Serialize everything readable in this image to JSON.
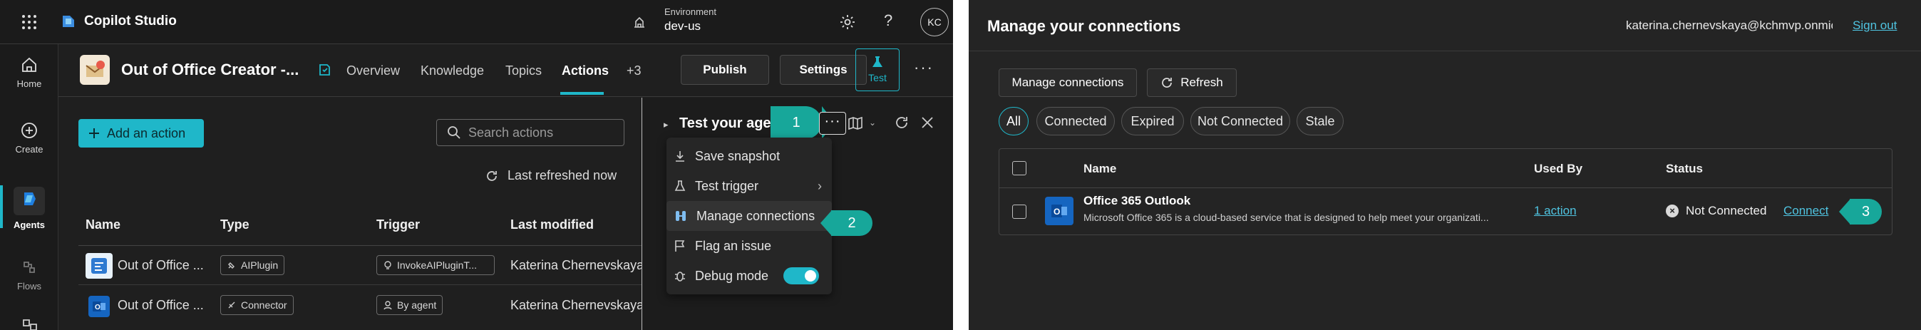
{
  "left": {
    "app_title": "Copilot Studio",
    "environment_label": "Environment",
    "environment_value": "dev-us",
    "avatar_initials": "KC",
    "rail": [
      "Home",
      "Create",
      "Agents",
      "Flows"
    ],
    "agent_name": "Out of Office Creator -...",
    "tabs": [
      "Overview",
      "Knowledge",
      "Topics",
      "Actions",
      "+3"
    ],
    "active_tab": "Actions",
    "publish_label": "Publish",
    "settings_label": "Settings",
    "test_label": "Test",
    "add_action_label": "Add an action",
    "search_placeholder": "Search actions",
    "refreshed_text": "Last refreshed now",
    "table_headers": [
      "Name",
      "Type",
      "Trigger",
      "Last modified"
    ],
    "rows": [
      {
        "name": "Out of Office ...",
        "type": "AIPlugin",
        "trigger": "InvokeAIPluginT...",
        "modified": "Katerina Chernevskaya..."
      },
      {
        "name": "Out of Office ...",
        "type": "Connector",
        "trigger": "By agent",
        "modified": "Katerina Chernevskaya..."
      }
    ],
    "test_panel_title": "Test your agent",
    "menu": [
      "Save snapshot",
      "Test trigger",
      "Manage connections",
      "Flag an issue",
      "Debug mode"
    ],
    "callouts": [
      "1",
      "2"
    ]
  },
  "right": {
    "title": "Manage your connections",
    "user_email": "katerina.chernevskaya@kchmvp.onmic...",
    "sign_out": "Sign out",
    "manage_connections_label": "Manage connections",
    "refresh_label": "Refresh",
    "filters": [
      "All",
      "Connected",
      "Expired",
      "Not Connected",
      "Stale"
    ],
    "table_headers": [
      "Name",
      "Used By",
      "Status"
    ],
    "row": {
      "name": "Office 365 Outlook",
      "description": "Microsoft Office 365 is a cloud-based service that is designed to help meet your organizati...",
      "used_by": "1 action",
      "status": "Not Connected",
      "action": "Connect"
    },
    "callout": "3"
  },
  "colors": {
    "accent": "#1fb7c9",
    "callout": "#17a79a",
    "link": "#4fc3e0"
  }
}
